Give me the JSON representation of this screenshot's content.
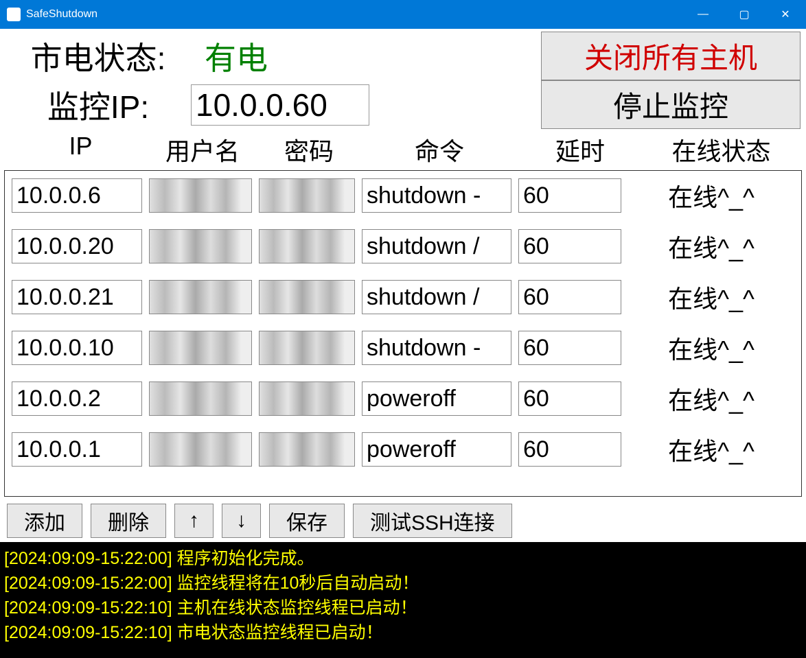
{
  "titlebar": {
    "title": "SafeShutdown"
  },
  "header": {
    "power_label": "市电状态:",
    "power_value": "有电",
    "monitor_ip_label": "监控IP:",
    "monitor_ip_value": "10.0.0.60",
    "shutdown_all_btn": "关闭所有主机",
    "stop_monitor_btn": "停止监控"
  },
  "columns": {
    "ip": "IP",
    "user": "用户名",
    "pass": "密码",
    "cmd": "命令",
    "delay": "延时",
    "status": "在线状态"
  },
  "hosts": [
    {
      "ip": "10.0.0.6",
      "user": "",
      "pass": "",
      "cmd": "shutdown -",
      "delay": "60",
      "status": "在线^_^"
    },
    {
      "ip": "10.0.0.20",
      "user": "",
      "pass": "",
      "cmd": "shutdown /",
      "delay": "60",
      "status": "在线^_^"
    },
    {
      "ip": "10.0.0.21",
      "user": "",
      "pass": "",
      "cmd": "shutdown /",
      "delay": "60",
      "status": "在线^_^"
    },
    {
      "ip": "10.0.0.10",
      "user": "",
      "pass": "",
      "cmd": "shutdown -",
      "delay": "60",
      "status": "在线^_^"
    },
    {
      "ip": "10.0.0.2",
      "user": "",
      "pass": "",
      "cmd": "poweroff",
      "delay": "60",
      "status": "在线^_^"
    },
    {
      "ip": "10.0.0.1",
      "user": "",
      "pass": "",
      "cmd": "poweroff",
      "delay": "60",
      "status": "在线^_^"
    }
  ],
  "actions": {
    "add": "添加",
    "delete": "删除",
    "up": "↑",
    "down": "↓",
    "save": "保存",
    "test_ssh": "测试SSH连接"
  },
  "log_lines": [
    "[2024:09:09-15:22:00] 程序初始化完成。",
    "[2024:09:09-15:22:00] 监控线程将在10秒后自动启动！",
    "[2024:09:09-15:22:10] 主机在线状态监控线程已启动！",
    "[2024:09:09-15:22:10] 市电状态监控线程已启动！"
  ]
}
